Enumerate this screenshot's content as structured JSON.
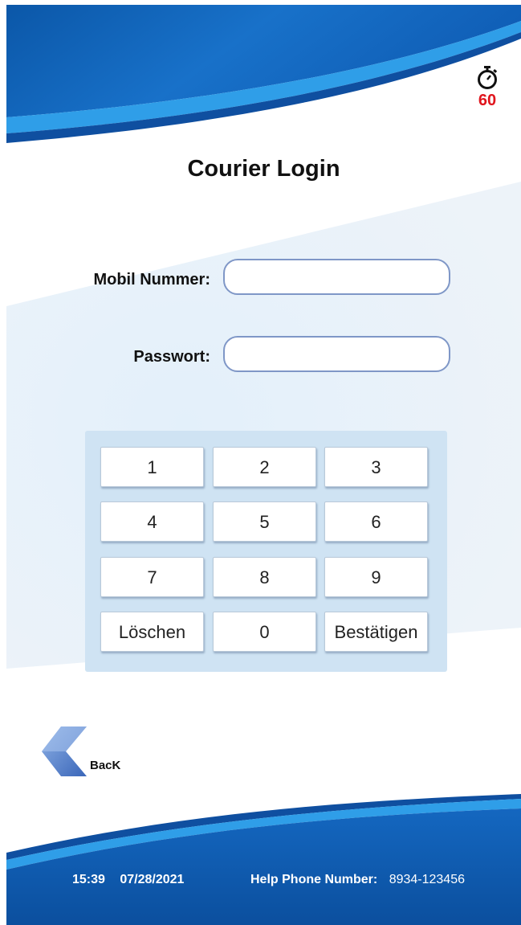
{
  "timer": {
    "icon": "stopwatch-icon",
    "seconds": "60",
    "color": "#e0151d"
  },
  "title": "Courier Login",
  "form": {
    "mobile_label": "Mobil Nummer:",
    "mobile_value": "",
    "password_label": "Passwort:",
    "password_value": ""
  },
  "keypad": {
    "keys": [
      "1",
      "2",
      "3",
      "4",
      "5",
      "6",
      "7",
      "8",
      "9",
      "Löschen",
      "0",
      "Bestätigen"
    ]
  },
  "back": {
    "label": "BacK",
    "icon": "back-arrow-icon"
  },
  "footer": {
    "time": "15:39",
    "date": "07/28/2021",
    "help_label": "Help Phone Number:",
    "help_number": "8934-123456"
  },
  "colors": {
    "brand_blue": "#0d57b0",
    "accent_blue": "#2f9ee8",
    "keypad_bg": "#cfe3f3"
  }
}
